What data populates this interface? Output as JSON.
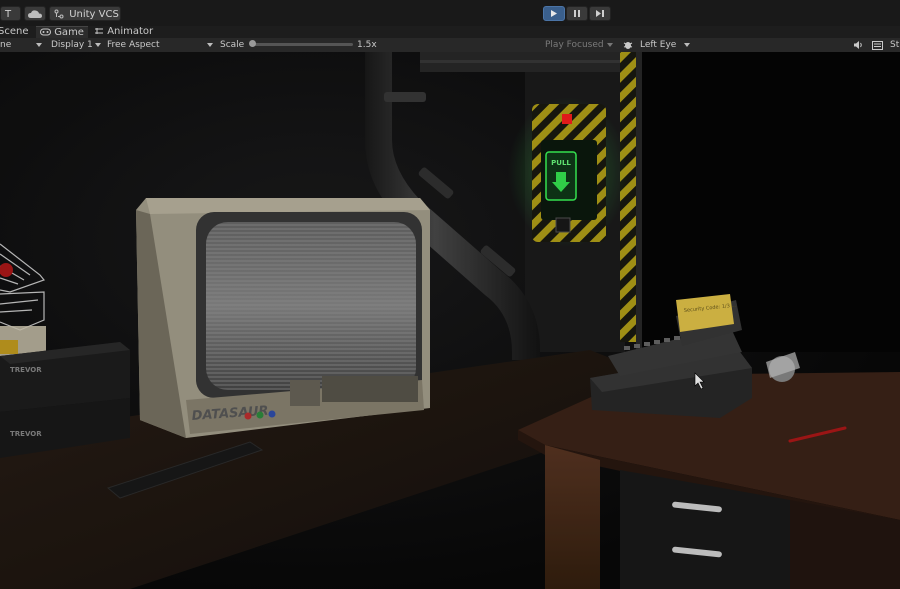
{
  "toolbar": {
    "account_label": "T",
    "vcs_label": "Unity VCS",
    "play_icon": "play-icon",
    "pause_icon": "pause-icon",
    "step_icon": "step-icon"
  },
  "tabs": [
    {
      "label": "Scene",
      "icon": "scene-icon"
    },
    {
      "label": "Game",
      "icon": "game-icon"
    },
    {
      "label": "Animator",
      "icon": "animator-icon"
    }
  ],
  "game_bar": {
    "mode_label": "ne",
    "display_label": "Display 1",
    "aspect_label": "Free Aspect",
    "scale_label": "Scale",
    "scale_value": "1.5x",
    "scale_fraction": 0.0,
    "play_focused_label": "Play Focused",
    "eye_label": "Left Eye",
    "stats_label": "St"
  },
  "scene": {
    "monitor_brand": "DATASAUR",
    "panel_label": "PULL",
    "vcr_label_1": "TREVOR",
    "vcr_label_2": "TREVOR",
    "sticky_note_text": "Security Code: 1/3 ...",
    "colors": {
      "panel_glow": "#3cff5a",
      "indicator_red": "#ff1e1e",
      "hazard_yellow": "#d8c21a",
      "desk_wood": "#4a2a1a"
    }
  }
}
